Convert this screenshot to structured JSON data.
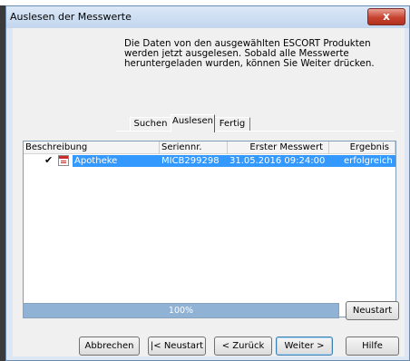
{
  "window": {
    "title": "Auslesen der Messwerte",
    "close_glyph": "x"
  },
  "info_text": "Die Daten von den ausgewählten ESCORT Produkten werden jetzt ausgelesen. Sobald alle Messwerte heruntergeladen wurden, können Sie Weiter drücken.",
  "tabs": [
    {
      "label": "Suchen",
      "active": false
    },
    {
      "label": "Auslesen",
      "active": true
    },
    {
      "label": "Fertig",
      "active": false
    }
  ],
  "table": {
    "columns": [
      "Beschreibung",
      "Seriennr.",
      "Erster Messwert",
      "Ergebnis"
    ],
    "rows": [
      {
        "checked": true,
        "check_glyph": "✔",
        "icon": "device-document-icon",
        "beschreibung": "Apotheke",
        "seriennr": "MICB299298",
        "erster_messwert": "31.05.2016  09:24:00",
        "ergebnis": "erfolgreich"
      }
    ]
  },
  "progress": {
    "value": 1.0,
    "text": "100%"
  },
  "buttons": {
    "neustart_side": "Neustart",
    "abbrechen": "Abbrechen",
    "neustart": "|< Neustart",
    "zurueck": "< Zurück",
    "weiter": "Weiter >",
    "hilfe": "Hilfe"
  },
  "colors": {
    "selection": "#3399ff",
    "progress_fill": "#90b2d4",
    "close_button": "#c7432f"
  }
}
